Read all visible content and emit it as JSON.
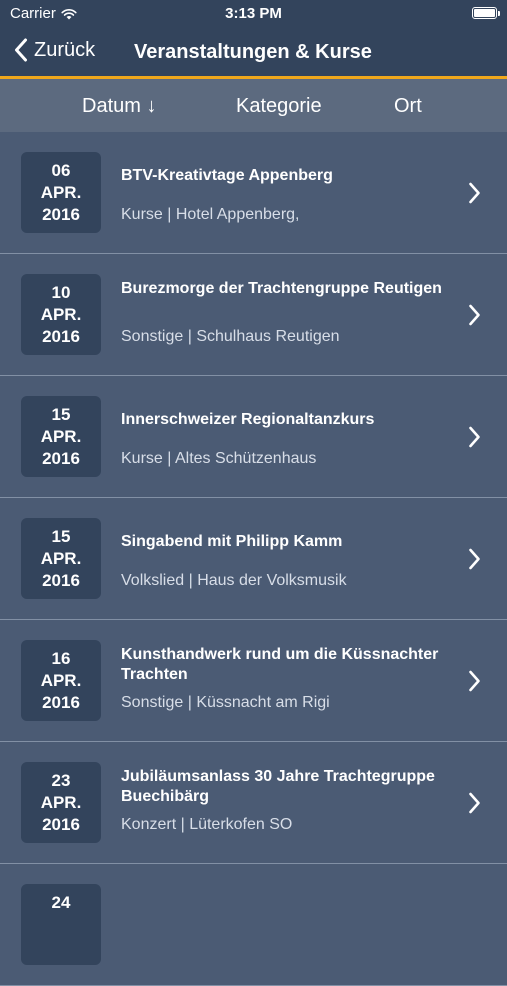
{
  "status_bar": {
    "carrier": "Carrier",
    "time": "3:13 PM"
  },
  "nav": {
    "back_label": "Zurück",
    "title": "Veranstaltungen & Kurse"
  },
  "sort": {
    "date_label": "Datum ↓",
    "category_label": "Kategorie",
    "place_label": "Ort"
  },
  "colors": {
    "accent": "#f0a81c",
    "nav_background": "#33445c",
    "list_background": "#4b5b74"
  },
  "events": [
    {
      "day": "06",
      "month": "APR.",
      "year": "2016",
      "title": "BTV-Kreativtage Appenberg",
      "meta": "Kurse | Hotel Appenberg,"
    },
    {
      "day": "10",
      "month": "APR.",
      "year": "2016",
      "title": "Burezmorge der Trachtengruppe Reutigen",
      "meta": "Sonstige | Schulhaus Reutigen"
    },
    {
      "day": "15",
      "month": "APR.",
      "year": "2016",
      "title": "Innerschweizer Regionaltanzkurs",
      "meta": "Kurse | Altes Schützenhaus"
    },
    {
      "day": "15",
      "month": "APR.",
      "year": "2016",
      "title": "Singabend mit Philipp Kamm",
      "meta": "Volkslied | Haus der Volksmusik"
    },
    {
      "day": "16",
      "month": "APR.",
      "year": "2016",
      "title": "Kunsthandwerk rund um die Küssnachter Trachten",
      "meta": "Sonstige | Küssnacht am Rigi"
    },
    {
      "day": "23",
      "month": "APR.",
      "year": "2016",
      "title": "Jubiläumsanlass 30 Jahre Trachtegruppe Buechibärg",
      "meta": "Konzert | Lüterkofen SO"
    },
    {
      "day": "24",
      "month": "",
      "year": "",
      "title": "",
      "meta": ""
    }
  ]
}
